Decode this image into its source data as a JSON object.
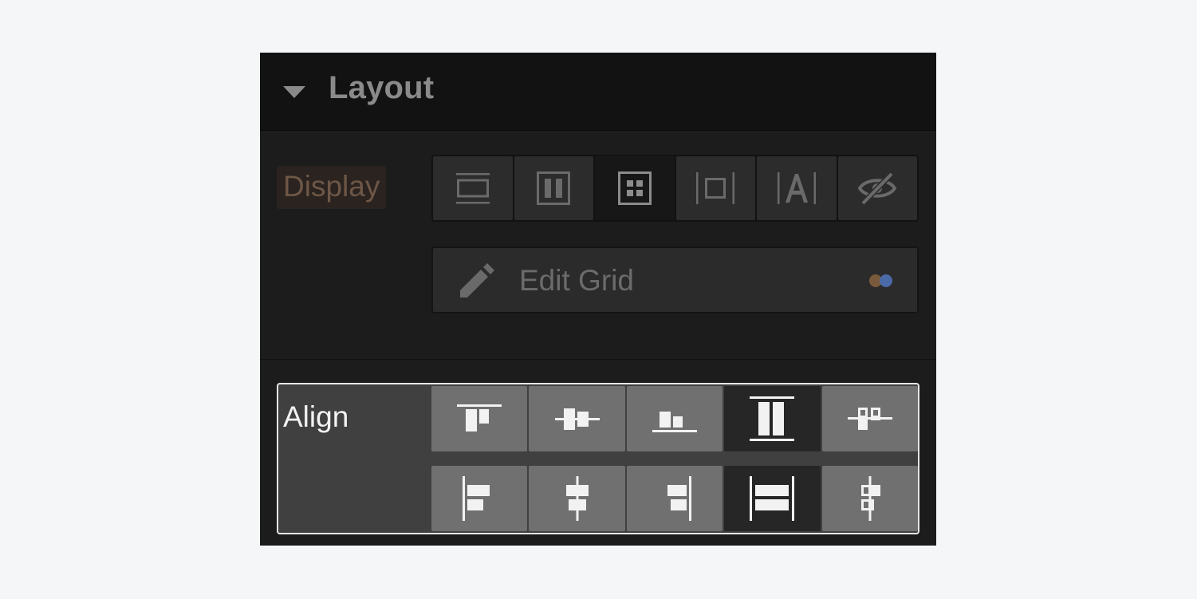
{
  "panel": {
    "title": "Layout"
  },
  "display": {
    "label": "Display",
    "options": [
      {
        "icon": "display-block-icon"
      },
      {
        "icon": "display-flex-icon"
      },
      {
        "icon": "display-grid-icon",
        "selected": true
      },
      {
        "icon": "display-inline-block-icon"
      },
      {
        "icon": "display-inline-icon"
      },
      {
        "icon": "display-none-icon"
      }
    ]
  },
  "edit_grid": {
    "label": "Edit Grid"
  },
  "align": {
    "label": "Align",
    "row1": [
      {
        "icon": "align-top-icon"
      },
      {
        "icon": "align-center-icon"
      },
      {
        "icon": "align-bottom-icon"
      },
      {
        "icon": "align-stretch-icon",
        "selected": true
      },
      {
        "icon": "align-baseline-icon"
      }
    ],
    "row2": [
      {
        "icon": "justify-left-icon"
      },
      {
        "icon": "justify-center-icon"
      },
      {
        "icon": "justify-right-icon"
      },
      {
        "icon": "justify-stretch-icon",
        "selected": true
      },
      {
        "icon": "justify-baseline-icon"
      }
    ]
  },
  "colors": {
    "panel_bg": "#1c1c1c",
    "header_bg": "#121212",
    "display_label": "#6e5746",
    "align_bg": "#404040",
    "highlight_border": "#e6e6e6"
  }
}
